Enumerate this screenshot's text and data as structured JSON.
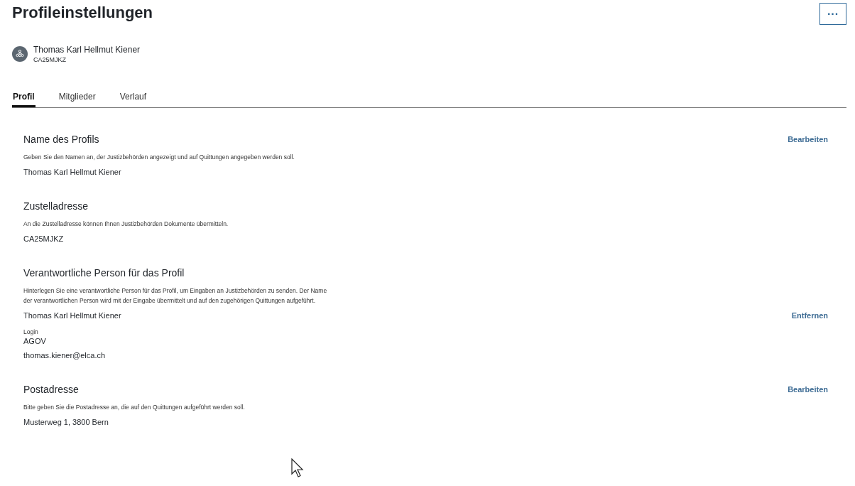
{
  "page_title": "Profileinstellungen",
  "more_button": {
    "label": "···"
  },
  "profile": {
    "name": "Thomas Karl Hellmut Kiener",
    "code": "CA25MJKZ"
  },
  "tabs": [
    {
      "label": "Profil",
      "selected": true
    },
    {
      "label": "Mitglieder",
      "selected": false
    },
    {
      "label": "Verlauf",
      "selected": false
    }
  ],
  "sections": [
    {
      "title": "Name des Profils",
      "description": "Geben Sie den Namen an, der Justizbehörden angezeigt und auf Quittungen angegeben werden soll.",
      "action": "Bearbeiten",
      "items": [
        {
          "kind": "value",
          "text": "Thomas Karl Hellmut Kiener"
        }
      ]
    },
    {
      "title": "Zustelladresse",
      "description": "An die Zustelladresse können Ihnen Justizbehörden Dokumente übermitteln.",
      "items": [
        {
          "kind": "value",
          "text": "CA25MJKZ"
        }
      ]
    },
    {
      "title": "Verantwortliche Person für das Profil",
      "description": "Hinterlegen Sie eine verantwortliche Person für das Profil, um Eingaben an Justizbehörden zu senden. Der Name der verantwortlichen Person wird mit der Eingabe übermittelt und auf den zugehörigen Quittungen aufgeführt.",
      "items": [
        {
          "kind": "value",
          "text": "Thomas Karl Hellmut Kiener",
          "action": "Entfernen"
        },
        {
          "kind": "label",
          "text": "Login"
        },
        {
          "kind": "value",
          "text": "AGOV"
        },
        {
          "kind": "value",
          "text": "thomas.kiener@elca.ch"
        }
      ]
    },
    {
      "title": "Postadresse",
      "description": "Bitte geben Sie die Postadresse an, die auf den Quittungen aufgeführt werden soll.",
      "action": "Bearbeiten",
      "items": [
        {
          "kind": "value",
          "text": "Musterweg 1, 3800 Bern"
        }
      ]
    }
  ]
}
